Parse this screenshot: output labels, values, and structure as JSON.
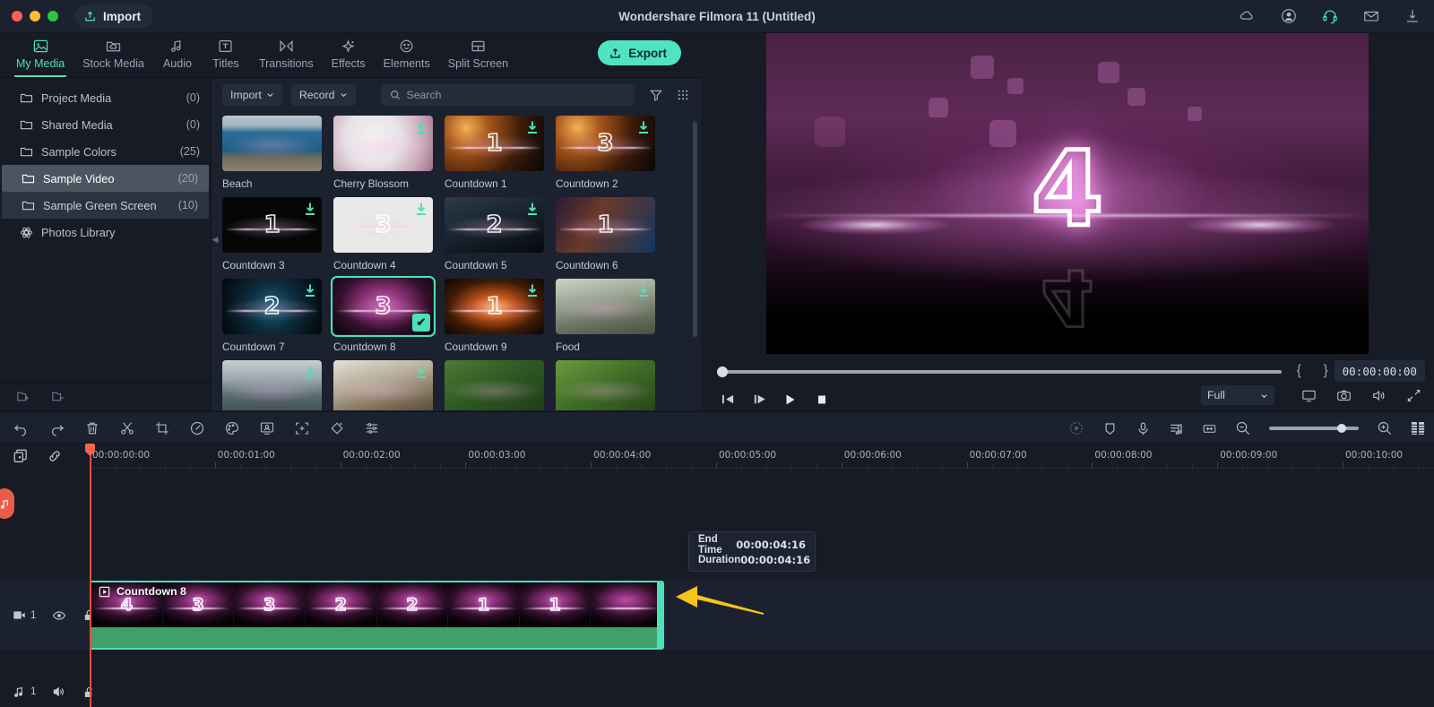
{
  "window": {
    "title": "Wondershare Filmora 11 (Untitled)",
    "import_label": "Import",
    "traffic_lights": [
      "close-red",
      "minimize-yellow",
      "maximize-green"
    ],
    "right_icons": [
      "cloud-icon",
      "account-icon",
      "headset-icon",
      "mail-icon",
      "download-icon"
    ]
  },
  "tabs": [
    {
      "label": "My Media",
      "icon": "image-icon",
      "active": true
    },
    {
      "label": "Stock Media",
      "icon": "folder-cloud-icon",
      "active": false
    },
    {
      "label": "Audio",
      "icon": "music-note-icon",
      "active": false
    },
    {
      "label": "Titles",
      "icon": "text-box-icon",
      "active": false
    },
    {
      "label": "Transitions",
      "icon": "transition-icon",
      "active": false
    },
    {
      "label": "Effects",
      "icon": "sparkle-icon",
      "active": false
    },
    {
      "label": "Elements",
      "icon": "smiley-icon",
      "active": false
    },
    {
      "label": "Split Screen",
      "icon": "split-screen-icon",
      "active": false
    }
  ],
  "export": {
    "label": "Export",
    "icon": "export-upload-icon",
    "color": "#50e3c2"
  },
  "sidebar": {
    "folders": [
      {
        "label": "Project Media",
        "count": "(0)",
        "state": "normal"
      },
      {
        "label": "Shared Media",
        "count": "(0)",
        "state": "normal"
      },
      {
        "label": "Sample Colors",
        "count": "(25)",
        "state": "normal"
      },
      {
        "label": "Sample Video",
        "count": "(20)",
        "state": "selected"
      },
      {
        "label": "Sample Green Screen",
        "count": "(10)",
        "state": "hover"
      },
      {
        "label": "Photos Library",
        "count": "",
        "state": "normal",
        "icon": "photos-library-icon"
      }
    ],
    "bottom_icons": [
      "add-folder-icon",
      "remove-folder-icon"
    ]
  },
  "media_toolbar": {
    "import_label": "Import",
    "record_label": "Record",
    "search_placeholder": "Search",
    "filter_icon": "filter-funnel-icon",
    "grid_icon": "grid-view-icon"
  },
  "media_grid": {
    "items": [
      {
        "label": "Beach",
        "art": "t-beach",
        "download": false,
        "selected": false,
        "num": ""
      },
      {
        "label": "Cherry Blossom",
        "art": "t-cherry",
        "download": true,
        "selected": false,
        "num": ""
      },
      {
        "label": "Countdown 1",
        "art": "t-cd1",
        "download": true,
        "selected": false,
        "num": "1"
      },
      {
        "label": "Countdown 2",
        "art": "t-cd2",
        "download": true,
        "selected": false,
        "num": "3"
      },
      {
        "label": "Countdown 3",
        "art": "t-cd3",
        "download": true,
        "selected": false,
        "num": "1"
      },
      {
        "label": "Countdown 4",
        "art": "t-cd4",
        "download": true,
        "selected": false,
        "num": "3"
      },
      {
        "label": "Countdown 5",
        "art": "t-cd5",
        "download": true,
        "selected": false,
        "num": "2"
      },
      {
        "label": "Countdown 6",
        "art": "t-cd6",
        "download": false,
        "selected": false,
        "num": "1"
      },
      {
        "label": "Countdown 7",
        "art": "t-cd7",
        "download": true,
        "selected": false,
        "num": "2"
      },
      {
        "label": "Countdown 8",
        "art": "t-cd8",
        "download": false,
        "selected": true,
        "num": "3"
      },
      {
        "label": "Countdown 9",
        "art": "t-cd9",
        "download": true,
        "selected": false,
        "num": "1"
      },
      {
        "label": "Food",
        "art": "t-food",
        "download": true,
        "selected": false,
        "num": ""
      },
      {
        "label": "",
        "art": "t-lake",
        "download": true,
        "selected": false,
        "num": ""
      },
      {
        "label": "",
        "art": "t-bowl",
        "download": true,
        "selected": false,
        "num": ""
      },
      {
        "label": "",
        "art": "t-bike",
        "download": false,
        "selected": false,
        "num": ""
      },
      {
        "label": "",
        "art": "t-bike2",
        "download": false,
        "selected": false,
        "num": ""
      }
    ]
  },
  "preview": {
    "frame_number": "4",
    "timecode": "00:00:00:00",
    "quality": "Full",
    "mark_in": "{",
    "mark_out": "}",
    "buttons": [
      "step-back-button",
      "step-forward-button",
      "play-button",
      "stop-button"
    ],
    "right_icons": [
      "display-icon",
      "snapshot-camera-icon",
      "volume-icon",
      "fullscreen-icon"
    ]
  },
  "timeline_toolbar": {
    "left_icons": [
      "undo-icon",
      "redo-icon",
      "delete-icon",
      "split-scissors-icon",
      "crop-icon",
      "speed-icon",
      "color-palette-icon",
      "green-screen-icon",
      "motion-tracking-icon",
      "mask-icon",
      "adjust-sliders-icon"
    ],
    "right_icons": [
      "render-preview-icon",
      "marker-icon",
      "voiceover-mic-icon",
      "audio-mixer-icon",
      "fit-timeline-icon",
      "zoom-out-icon",
      "zoom-in-icon",
      "detach-icon"
    ]
  },
  "timeline": {
    "ruler_labels": [
      "00:00:00:00",
      "00:00:01:00",
      "00:00:02:00",
      "00:00:03:00",
      "00:00:04:00",
      "00:00:05:00",
      "00:00:06:00",
      "00:00:07:00",
      "00:00:08:00",
      "00:00:09:00",
      "00:00:10:00"
    ],
    "top_left_icons": [
      "add-media-track-icon",
      "link-unlink-icon"
    ],
    "video_track": {
      "number": "1",
      "icons": [
        "video-track-icon",
        "eye-visibility-icon",
        "unlock-icon"
      ]
    },
    "audio_track": {
      "number": "1",
      "icons": [
        "audio-track-icon",
        "speaker-mute-icon",
        "unlock-icon"
      ]
    },
    "clip": {
      "title": "Countdown 8",
      "icon": "video-clip-icon",
      "thumb_numbers": [
        "4",
        "3",
        "3",
        "2",
        "2",
        "1",
        "1",
        ""
      ],
      "badge_icon": "audio-detach-badge"
    },
    "tooltip": {
      "end_time_label": "End Time",
      "end_time_value": "00:00:04:16",
      "duration_label": "Duration",
      "duration_value": "00:00:04:16"
    },
    "annotation": {
      "arrow_color": "#f5c518",
      "points_to": "clip-right-trim-handle"
    }
  }
}
